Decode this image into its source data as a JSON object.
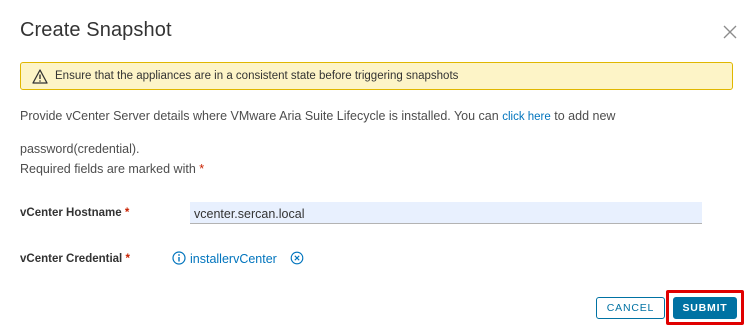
{
  "dialog": {
    "title": "Create Snapshot",
    "warning": "Ensure that the appliances are in a consistent state before triggering snapshots",
    "description_prefix": "Provide vCenter Server details where VMware Aria Suite Lifecycle is installed. You can",
    "description_link": "click here",
    "description_suffix": "to add new",
    "description_line2": "password(credential).",
    "required_note": "Required fields are marked with",
    "required_marker": "*"
  },
  "form": {
    "hostname_label": "vCenter Hostname",
    "hostname_value": "vcenter.sercan.local",
    "credential_label": "vCenter Credential",
    "credential_value": "installervCenter",
    "required_marker": "*"
  },
  "buttons": {
    "cancel": "CANCEL",
    "submit": "SUBMIT"
  },
  "colors": {
    "accent": "#0072a3",
    "link": "#0074bd",
    "warning_bg": "#fdf4c7",
    "warning_border": "#e0b700",
    "required": "#c92100",
    "highlight": "#e00000"
  },
  "icons": {
    "close": "close-icon",
    "warning": "warning-icon",
    "info": "info-icon",
    "clear": "clear-circle-icon"
  }
}
